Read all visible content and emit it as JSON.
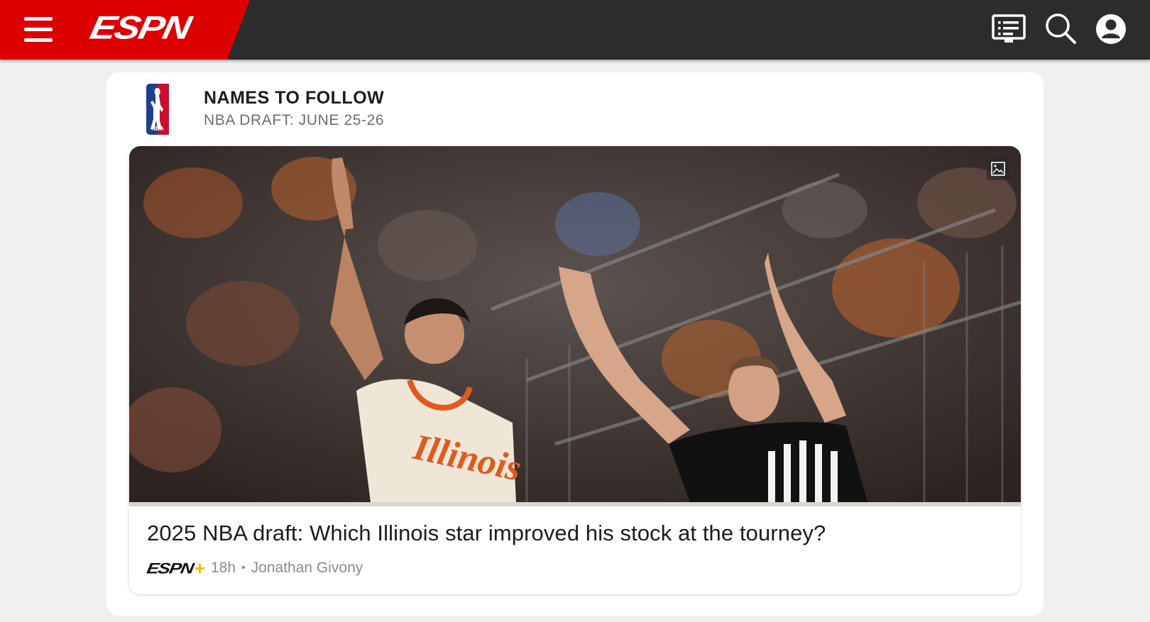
{
  "header": {
    "brand": "ESPN",
    "colors": {
      "brand_red": "#dd0000",
      "bar": "#2b2c2d"
    },
    "icons": [
      "menu-icon",
      "scores-icon",
      "search-icon",
      "profile-icon"
    ]
  },
  "module": {
    "title": "NAMES TO FOLLOW",
    "subtitle": "NBA DRAFT: JUNE 25-26",
    "league_logo": "NBA",
    "story": {
      "headline": "2025 NBA draft: Which Illinois star improved his stock at the tourney?",
      "source_wordmark": "ESPN",
      "source_plus": "+",
      "age": "18h",
      "separator": "•",
      "author": "Jonathan Givony",
      "image_icon": "gallery-icon",
      "image_jersey_text": "Illinois"
    }
  }
}
